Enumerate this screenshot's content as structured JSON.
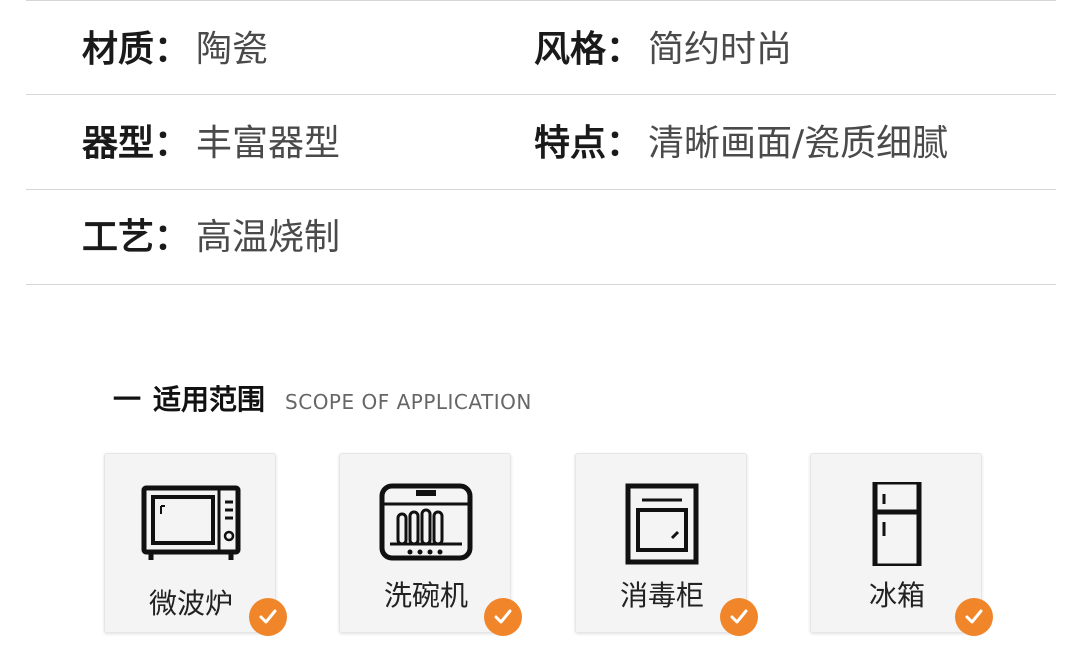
{
  "specs": [
    {
      "key": "材质",
      "value": "陶瓷"
    },
    {
      "key": "风格",
      "value": "简约时尚"
    },
    {
      "key": "器型",
      "value": "丰富器型"
    },
    {
      "key": "特点",
      "value": "清晰画面/瓷质细腻"
    },
    {
      "key": "工艺",
      "value": "高温烧制"
    }
  ],
  "colon": "：",
  "section": {
    "dash": "一",
    "title": "适用范围",
    "subtitle": "SCOPE OF APPLICATION"
  },
  "scope_items": [
    {
      "label": "微波炉",
      "icon": "microwave-icon",
      "checked": true
    },
    {
      "label": "洗碗机",
      "icon": "dishwasher-icon",
      "checked": true
    },
    {
      "label": "消毒柜",
      "icon": "sterilizer-cabinet-icon",
      "checked": true
    },
    {
      "label": "冰箱",
      "icon": "refrigerator-icon",
      "checked": true
    }
  ],
  "colors": {
    "accent": "#f0852a",
    "divider": "#d6d6d6",
    "card_bg": "#f4f4f4"
  }
}
